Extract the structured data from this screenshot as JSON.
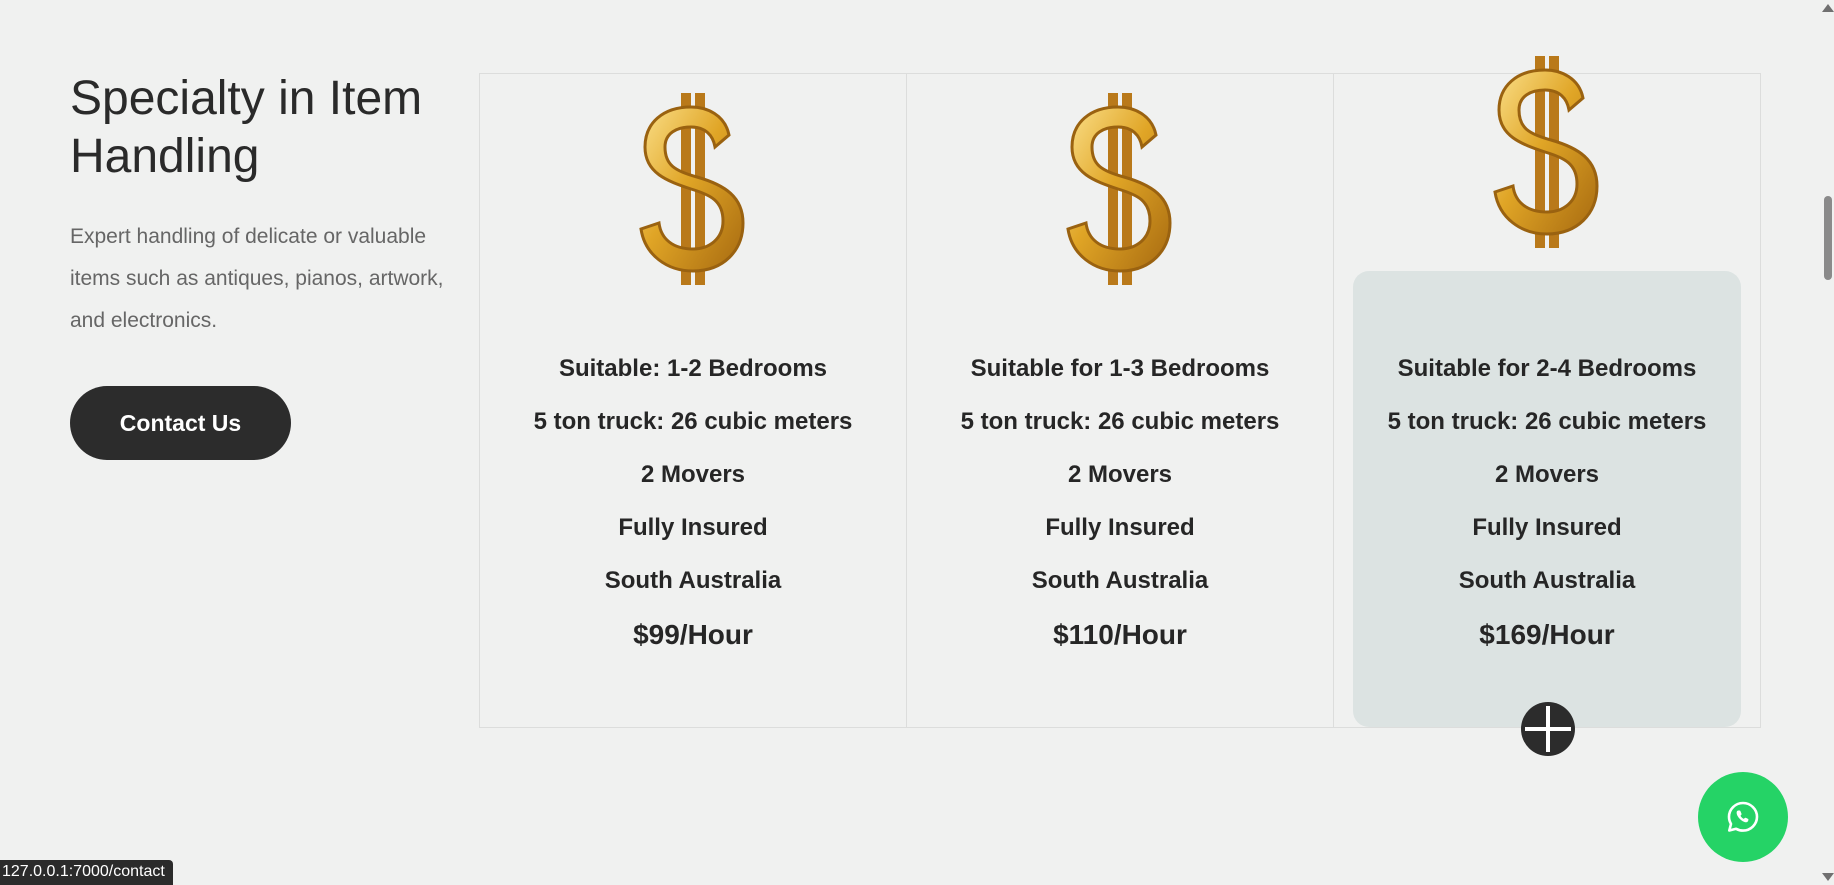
{
  "intro": {
    "title": "Specialty in Item Handling",
    "description": "Expert handling of delicate or valuable items such as antiques, pianos, artwork, and electronics.",
    "contact_label": "Contact Us"
  },
  "plans": [
    {
      "suitable": "Suitable: 1-2 Bedrooms",
      "truck": "5 ton truck: 26 cubic meters",
      "movers": "2 Movers",
      "insured": "Fully Insured",
      "region": "South Australia",
      "price": "$99/Hour",
      "icon": "dollar-sign-icon"
    },
    {
      "suitable": "Suitable for 1-3 Bedrooms",
      "truck": "5 ton truck: 26 cubic meters",
      "movers": "2 Movers",
      "insured": "Fully Insured",
      "region": "South Australia",
      "price": "$110/Hour",
      "icon": "dollar-sign-icon"
    },
    {
      "suitable": "Suitable for 2-4 Bedrooms",
      "truck": "5 ton truck: 26 cubic meters",
      "movers": "2 Movers",
      "insured": "Fully Insured",
      "region": "South Australia",
      "price": "$169/Hour",
      "icon": "dollar-sign-icon"
    }
  ],
  "floating": {
    "plus_icon": "plus-circle-icon",
    "whatsapp_icon": "whatsapp-icon"
  },
  "status_bar": {
    "url": "127.0.0.1:7000/contact"
  },
  "colors": {
    "background": "#f0f1f0",
    "button": "#2c2c2c",
    "featured_card": "#dce3e2",
    "whatsapp": "#25d366",
    "gold": "#e0a526"
  }
}
